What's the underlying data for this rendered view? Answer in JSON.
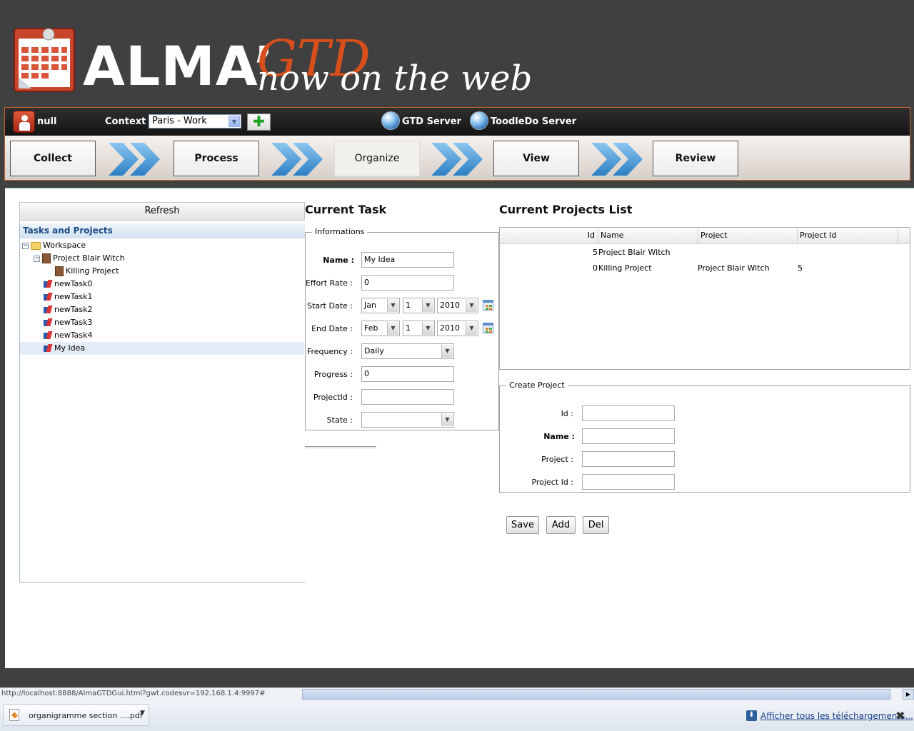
{
  "app": {
    "logo_main": "ALMA’",
    "logo_gtd": "GTD",
    "logo_tagline": "now on the web"
  },
  "toolbar": {
    "user": "null",
    "context_label": "Context",
    "context_value": "Paris - Work",
    "gtd_server": "GTD Server",
    "toodledo_server": "ToodleDo Server"
  },
  "steps": [
    "Collect",
    "Process",
    "Organize",
    "View",
    "Review"
  ],
  "active_step": "Organize",
  "tree": {
    "refresh_label": "Refresh",
    "header": "Tasks and Projects",
    "items": [
      {
        "label": "Workspace",
        "type": "folder",
        "expander": "−"
      },
      {
        "label": "Project Blair Witch",
        "type": "project",
        "expander": "−"
      },
      {
        "label": "Killing Project",
        "type": "project"
      },
      {
        "label": "newTask0",
        "type": "task"
      },
      {
        "label": "newTask1",
        "type": "task"
      },
      {
        "label": "newTask2",
        "type": "task"
      },
      {
        "label": "newTask3",
        "type": "task"
      },
      {
        "label": "newTask4",
        "type": "task"
      },
      {
        "label": "My Idea",
        "type": "task",
        "selected": true
      }
    ]
  },
  "task": {
    "title": "Current Task",
    "legend": "Informations",
    "name_label": "Name :",
    "name_value": "My Idea",
    "effort_label": "Effort Rate :",
    "effort_value": "0",
    "start_label": "Start Date :",
    "start_month": "Jan",
    "start_day": "1",
    "start_year": "2010",
    "end_label": "End Date :",
    "end_month": "Feb",
    "end_day": "1",
    "end_year": "2010",
    "frequency_label": "Frequency :",
    "frequency_value": "Daily",
    "progress_label": "Progress :",
    "progress_value": "0",
    "projectid_label": "ProjectId :",
    "projectid_value": "",
    "state_label": "State :",
    "state_value": ""
  },
  "projects": {
    "title": "Current Projects List",
    "columns": [
      "Id",
      "Name",
      "Project",
      "Project Id"
    ],
    "rows": [
      {
        "id": "5",
        "name": "Project Blair Witch",
        "project": "",
        "project_id": ""
      },
      {
        "id": "0",
        "name": "Killing Project",
        "project": "Project Blair Witch",
        "project_id": "5"
      }
    ]
  },
  "create_project": {
    "legend": "Create Project",
    "id_label": "Id :",
    "name_label": "Name :",
    "project_label": "Project :",
    "projectid_label": "Project Id :",
    "save_label": "Save",
    "add_label": "Add",
    "del_label": "Del"
  },
  "browser": {
    "status_url": "http://localhost:8888/AlmaGTDGui.html?gwt.codesvr=192.168.1.4:9997#",
    "download_name": "organigramme section ....pdf",
    "show_all_downloads": "Afficher tous les téléchargements...",
    "close_glyph": "✖"
  },
  "colors": {
    "accent": "#d94f1c",
    "background": "#404040",
    "tree_header": "#1a4a86"
  }
}
